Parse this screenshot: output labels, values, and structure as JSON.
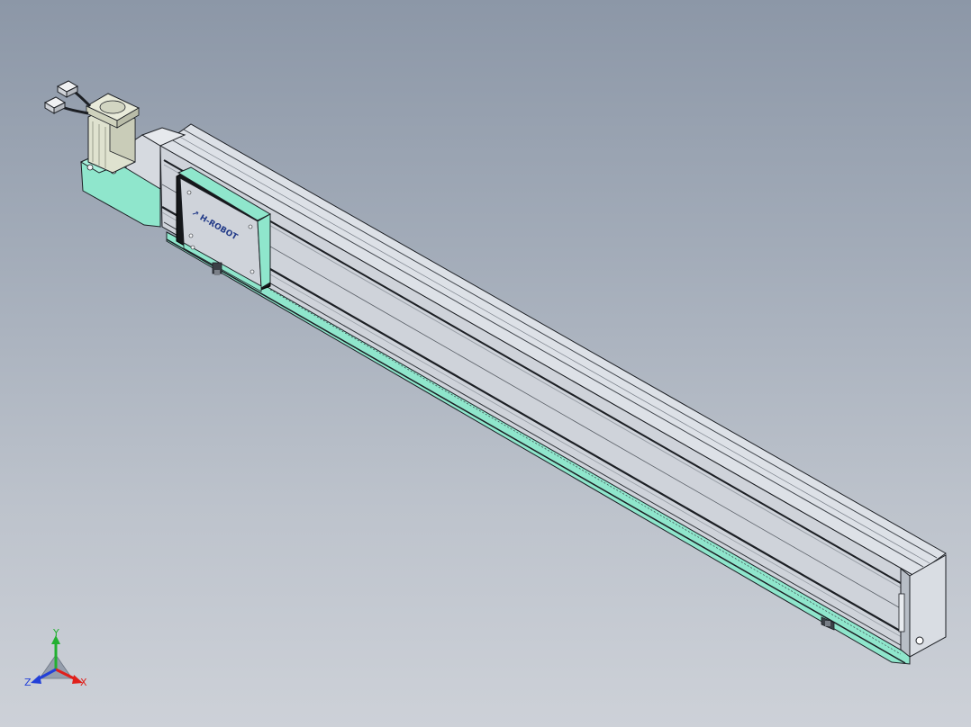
{
  "viewport": {
    "background_top": "#8c97a7",
    "background_bottom": "#cdd1d8"
  },
  "model": {
    "carriage_logo_text": "↗ H-ROBOT",
    "accent_color": "#8fe6cc",
    "body_color": "#cdd2d9",
    "outline_color": "#1c1f24"
  },
  "triad": {
    "x_label": "X",
    "y_label": "Y",
    "z_label": "Z",
    "x_color": "#e0201b",
    "y_color": "#22b030",
    "z_color": "#2340d8"
  }
}
